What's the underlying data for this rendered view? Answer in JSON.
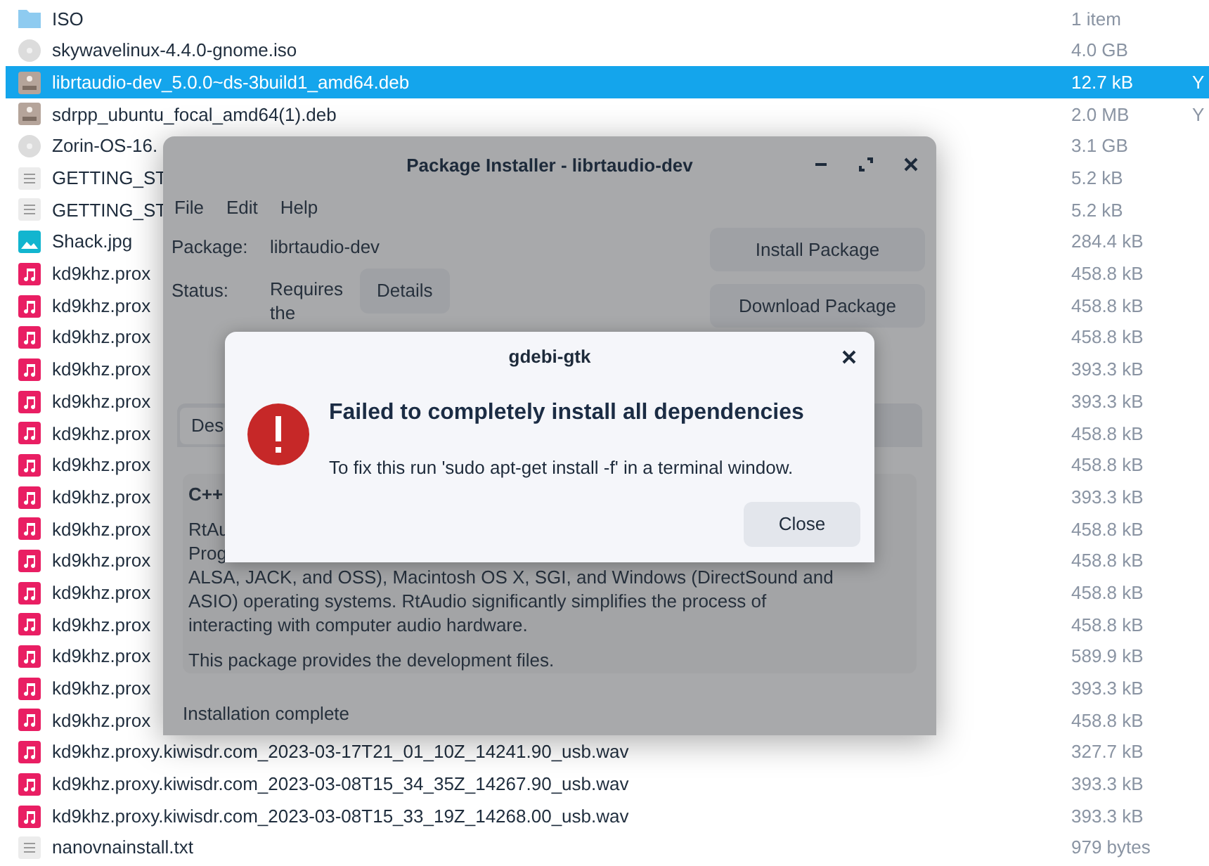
{
  "files": [
    {
      "kind": "folder",
      "name": "ISO",
      "size": "1 item",
      "selected": false
    },
    {
      "kind": "disc",
      "name": "skywavelinux-4.4.0-gnome.iso",
      "size": "4.0 GB",
      "selected": false
    },
    {
      "kind": "deb",
      "name": "librtaudio-dev_5.0.0~ds-3build1_amd64.deb",
      "size": "12.7 kB",
      "column_3": "Y",
      "selected": true
    },
    {
      "kind": "deb",
      "name": "sdrpp_ubuntu_focal_amd64(1).deb",
      "size": "2.0 MB",
      "column_3": "Y",
      "selected": false
    },
    {
      "kind": "disc",
      "name": "Zorin-OS-16.",
      "size": "3.1 GB",
      "selected": false
    },
    {
      "kind": "text",
      "name": "GETTING_ST",
      "size": "5.2 kB",
      "selected": false
    },
    {
      "kind": "text",
      "name": "GETTING_ST",
      "size": "5.2 kB",
      "selected": false
    },
    {
      "kind": "image",
      "name": "Shack.jpg",
      "size": "284.4 kB",
      "selected": false
    },
    {
      "kind": "audio",
      "name": "kd9khz.prox",
      "size": "458.8 kB",
      "selected": false
    },
    {
      "kind": "audio",
      "name": "kd9khz.prox",
      "size": "458.8 kB",
      "selected": false
    },
    {
      "kind": "audio",
      "name": "kd9khz.prox",
      "size": "458.8 kB",
      "selected": false
    },
    {
      "kind": "audio",
      "name": "kd9khz.prox",
      "size": "393.3 kB",
      "selected": false
    },
    {
      "kind": "audio",
      "name": "kd9khz.prox",
      "size": "393.3 kB",
      "selected": false
    },
    {
      "kind": "audio",
      "name": "kd9khz.prox",
      "size": "458.8 kB",
      "selected": false
    },
    {
      "kind": "audio",
      "name": "kd9khz.prox",
      "size": "458.8 kB",
      "selected": false
    },
    {
      "kind": "audio",
      "name": "kd9khz.prox",
      "size": "393.3 kB",
      "selected": false
    },
    {
      "kind": "audio",
      "name": "kd9khz.prox",
      "size": "458.8 kB",
      "selected": false
    },
    {
      "kind": "audio",
      "name": "kd9khz.prox",
      "size": "458.8 kB",
      "selected": false
    },
    {
      "kind": "audio",
      "name": "kd9khz.prox",
      "size": "458.8 kB",
      "selected": false
    },
    {
      "kind": "audio",
      "name": "kd9khz.prox",
      "size": "458.8 kB",
      "selected": false
    },
    {
      "kind": "audio",
      "name": "kd9khz.prox",
      "size": "589.9 kB",
      "selected": false
    },
    {
      "kind": "audio",
      "name": "kd9khz.prox",
      "size": "393.3 kB",
      "selected": false
    },
    {
      "kind": "audio",
      "name": "kd9khz.prox",
      "size": "458.8 kB",
      "selected": false
    },
    {
      "kind": "audio",
      "name": "kd9khz.proxy.kiwisdr.com_2023-03-17T21_01_10Z_14241.90_usb.wav",
      "size": "327.7 kB",
      "selected": false
    },
    {
      "kind": "audio",
      "name": "kd9khz.proxy.kiwisdr.com_2023-03-08T15_34_35Z_14267.90_usb.wav",
      "size": "393.3 kB",
      "selected": false
    },
    {
      "kind": "audio",
      "name": "kd9khz.proxy.kiwisdr.com_2023-03-08T15_33_19Z_14268.00_usb.wav",
      "size": "393.3 kB",
      "selected": false
    },
    {
      "kind": "text",
      "name": "nanovnainstall.txt",
      "size": "979 bytes",
      "selected": false
    }
  ],
  "installer": {
    "title": "Package Installer - librtaudio-dev",
    "menu": [
      "File",
      "Edit",
      "Help"
    ],
    "package_label": "Package:",
    "package_value": "librtaudio-dev",
    "status_label": "Status:",
    "status_lines": [
      "Requires",
      "the"
    ],
    "details_button": "Details",
    "buttons": [
      "Install Package",
      "Download Package"
    ],
    "tab": "Des",
    "description": {
      "heading": "C++",
      "cut_lines": [
        "RtAu",
        "Prog"
      ],
      "lines": [
        "ALSA, JACK, and OSS), Macintosh OS X, SGI, and Windows (DirectSound and",
        "ASIO) operating systems. RtAudio significantly simplifies the process of",
        "interacting with computer audio hardware."
      ],
      "note": "This package provides the development files."
    },
    "status_bar": "Installation complete"
  },
  "dialog": {
    "title": "gdebi-gtk",
    "heading": "Failed to completely install all dependencies",
    "message": "To fix this run 'sudo apt-get install -f' in a terminal window.",
    "button": "Close"
  }
}
